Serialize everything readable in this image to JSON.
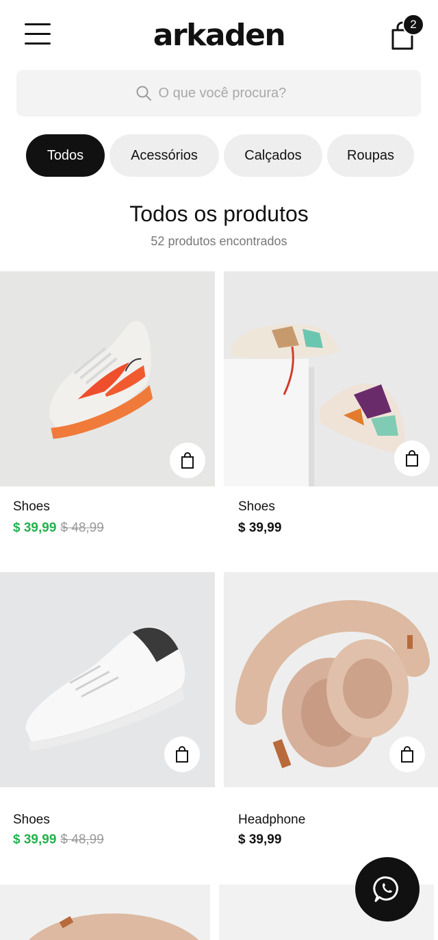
{
  "header": {
    "logo": "arkaden",
    "cart_count": "2"
  },
  "search": {
    "placeholder": "O que você procura?"
  },
  "categories": [
    {
      "label": "Todos",
      "active": true
    },
    {
      "label": "Acessórios",
      "active": false
    },
    {
      "label": "Calçados",
      "active": false
    },
    {
      "label": "Roupas",
      "active": false
    }
  ],
  "listing": {
    "title": "Todos os produtos",
    "count_text": "52 produtos encontrados"
  },
  "products": [
    {
      "name": "Shoes",
      "price": "$ 39,99",
      "old_price": "$ 48,99",
      "on_sale": true
    },
    {
      "name": "Shoes",
      "price": "$ 39,99",
      "old_price": "",
      "on_sale": false
    },
    {
      "name": "Shoes",
      "price": "$ 39,99",
      "old_price": "$ 48,99",
      "on_sale": true
    },
    {
      "name": "Headphone",
      "price": "$ 39,99",
      "old_price": "",
      "on_sale": false
    }
  ],
  "product_images": [
    "orange-sneaker",
    "colorful-sneakers-on-box",
    "white-sneaker",
    "beige-headphones"
  ],
  "colors": {
    "accent_green": "#22b14c",
    "primary": "#111111",
    "chip_bg": "#eeeeee"
  },
  "icons": [
    "menu-icon",
    "shopping-bag-icon",
    "search-icon",
    "whatsapp-icon"
  ]
}
